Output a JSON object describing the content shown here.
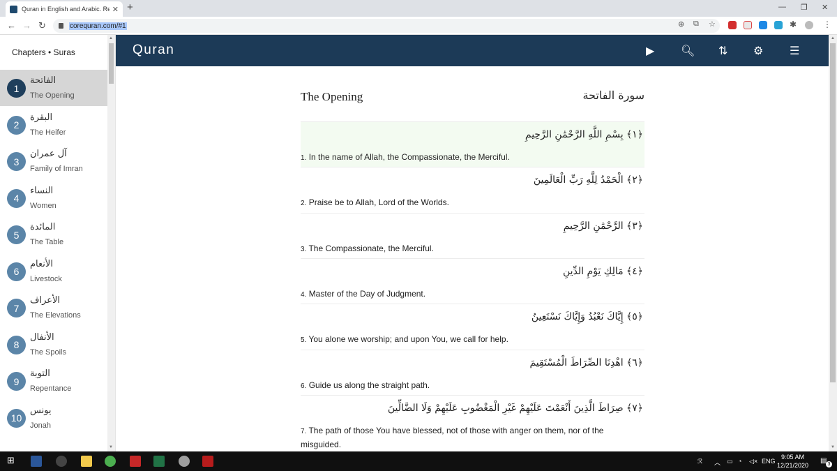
{
  "browser": {
    "tab_title": "Quran in English and Arabic. Rea",
    "tab_close": "✕",
    "new_tab": "+",
    "url": "corequran.com/#1",
    "window_controls": [
      "—",
      "❐",
      "✕"
    ]
  },
  "sidebar": {
    "title": "Chapters • Suras",
    "chapters": [
      {
        "number": "1",
        "arabic": "الفاتحة",
        "english": "The Opening",
        "active": true
      },
      {
        "number": "2",
        "arabic": "البقرة",
        "english": "The Heifer"
      },
      {
        "number": "3",
        "arabic": "آل عمران",
        "english": "Family of Imran"
      },
      {
        "number": "4",
        "arabic": "النساء",
        "english": "Women"
      },
      {
        "number": "5",
        "arabic": "المائدة",
        "english": "The Table"
      },
      {
        "number": "6",
        "arabic": "الأنعام",
        "english": "Livestock"
      },
      {
        "number": "7",
        "arabic": "الأعراف",
        "english": "The Elevations"
      },
      {
        "number": "8",
        "arabic": "الأنفال",
        "english": "The Spoils"
      },
      {
        "number": "9",
        "arabic": "التوبة",
        "english": "Repentance"
      },
      {
        "number": "10",
        "arabic": "يونس",
        "english": "Jonah"
      }
    ]
  },
  "header": {
    "brand": "Quran",
    "icons": [
      "play-icon",
      "search-icon",
      "sort-icon",
      "gear-icon",
      "menu-icon"
    ]
  },
  "sura": {
    "english_name": "The Opening",
    "arabic_name": "سورة الفاتحة",
    "verses": [
      {
        "arabic": "﴿١﴾ بِسْمِ اللَّهِ الرَّحْمَٰنِ الرَّحِيمِ",
        "num": "1.",
        "english": "In the name of Allah, the Compassionate, the Merciful.",
        "highlight": true
      },
      {
        "arabic": "﴿٢﴾ الْحَمْدُ لِلَّهِ رَبِّ الْعَالَمِينَ",
        "num": "2.",
        "english": "Praise be to Allah, Lord of the Worlds."
      },
      {
        "arabic": "﴿٣﴾ الرَّحْمَٰنِ الرَّحِيمِ",
        "num": "3.",
        "english": "The Compassionate, the Merciful."
      },
      {
        "arabic": "﴿٤﴾ مَالِكِ يَوْمِ الدِّينِ",
        "num": "4.",
        "english": "Master of the Day of Judgment."
      },
      {
        "arabic": "﴿٥﴾ إِيَّاكَ نَعْبُدُ وَإِيَّاكَ نَسْتَعِينُ",
        "num": "5.",
        "english": "You alone we worship; and upon You, we call for help."
      },
      {
        "arabic": "﴿٦﴾ اهْدِنَا الصِّرَاطَ الْمُسْتَقِيمَ",
        "num": "6.",
        "english": "Guide us along the straight path."
      },
      {
        "arabic": "﴿٧﴾ صِرَاطَ الَّذِينَ أَنْعَمْتَ عَلَيْهِمْ غَيْرِ الْمَغْضُوبِ عَلَيْهِمْ وَلَا الضَّالِّينَ",
        "num": "7.",
        "english": "The path of those You have blessed, not of those with anger on them, nor of the misguided."
      }
    ]
  },
  "taskbar": {
    "time": "9:05 AM",
    "date": "12/21/2020",
    "lang": "ENG",
    "notification_count": "3"
  }
}
